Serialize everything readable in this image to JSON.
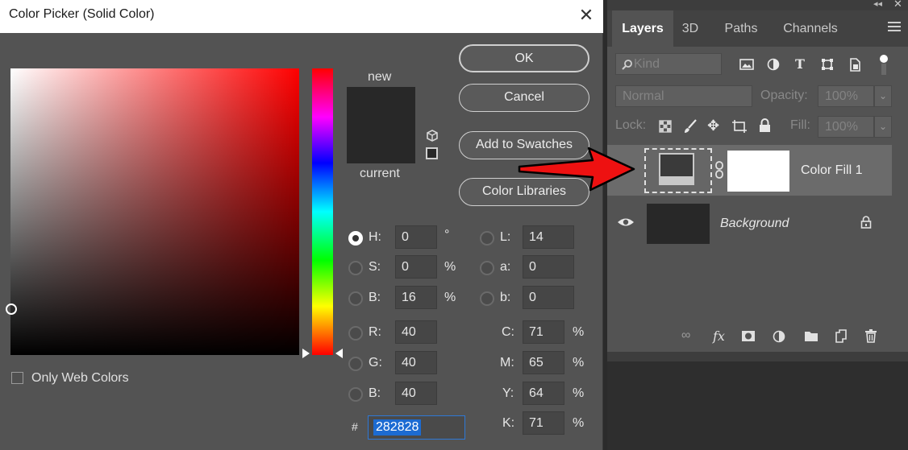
{
  "dialog": {
    "title": "Color Picker (Solid Color)",
    "close_glyph": "✕",
    "labels": {
      "new": "new",
      "current": "current"
    },
    "buttons": {
      "ok": "OK",
      "cancel": "Cancel",
      "add_swatches": "Add to Swatches",
      "color_libraries": "Color Libraries"
    },
    "fields": {
      "H": {
        "label": "H:",
        "value": "0",
        "unit": "°"
      },
      "S": {
        "label": "S:",
        "value": "0",
        "unit": "%"
      },
      "B": {
        "label": "B:",
        "value": "16",
        "unit": "%"
      },
      "R": {
        "label": "R:",
        "value": "40"
      },
      "G": {
        "label": "G:",
        "value": "40"
      },
      "Bb": {
        "label": "B:",
        "value": "40"
      },
      "L": {
        "label": "L:",
        "value": "14"
      },
      "a": {
        "label": "a:",
        "value": "0"
      },
      "b": {
        "label": "b:",
        "value": "0"
      },
      "C": {
        "label": "C:",
        "value": "71",
        "unit": "%"
      },
      "M": {
        "label": "M:",
        "value": "65",
        "unit": "%"
      },
      "Y": {
        "label": "Y:",
        "value": "64",
        "unit": "%"
      },
      "K": {
        "label": "K:",
        "value": "71",
        "unit": "%"
      }
    },
    "hex": {
      "label": "#",
      "value": "282828"
    },
    "only_web_colors": "Only Web Colors",
    "colors": {
      "new": "#282828",
      "current": "#282828",
      "hue": "#ff0000"
    }
  },
  "layers_panel": {
    "tabs": [
      "Layers",
      "3D",
      "Paths",
      "Channels"
    ],
    "filter_placeholder": "Kind",
    "blend_mode": "Normal",
    "opacity_label": "Opacity:",
    "opacity_value": "100%",
    "lock_label": "Lock:",
    "fill_label": "Fill:",
    "fill_value": "100%",
    "layers": [
      {
        "name": "Color Fill 1",
        "selected": true
      },
      {
        "name": "Background",
        "locked": true,
        "visible": true
      }
    ],
    "header_glyphs": {
      "collapse": "◂◂",
      "close": "✕"
    }
  }
}
